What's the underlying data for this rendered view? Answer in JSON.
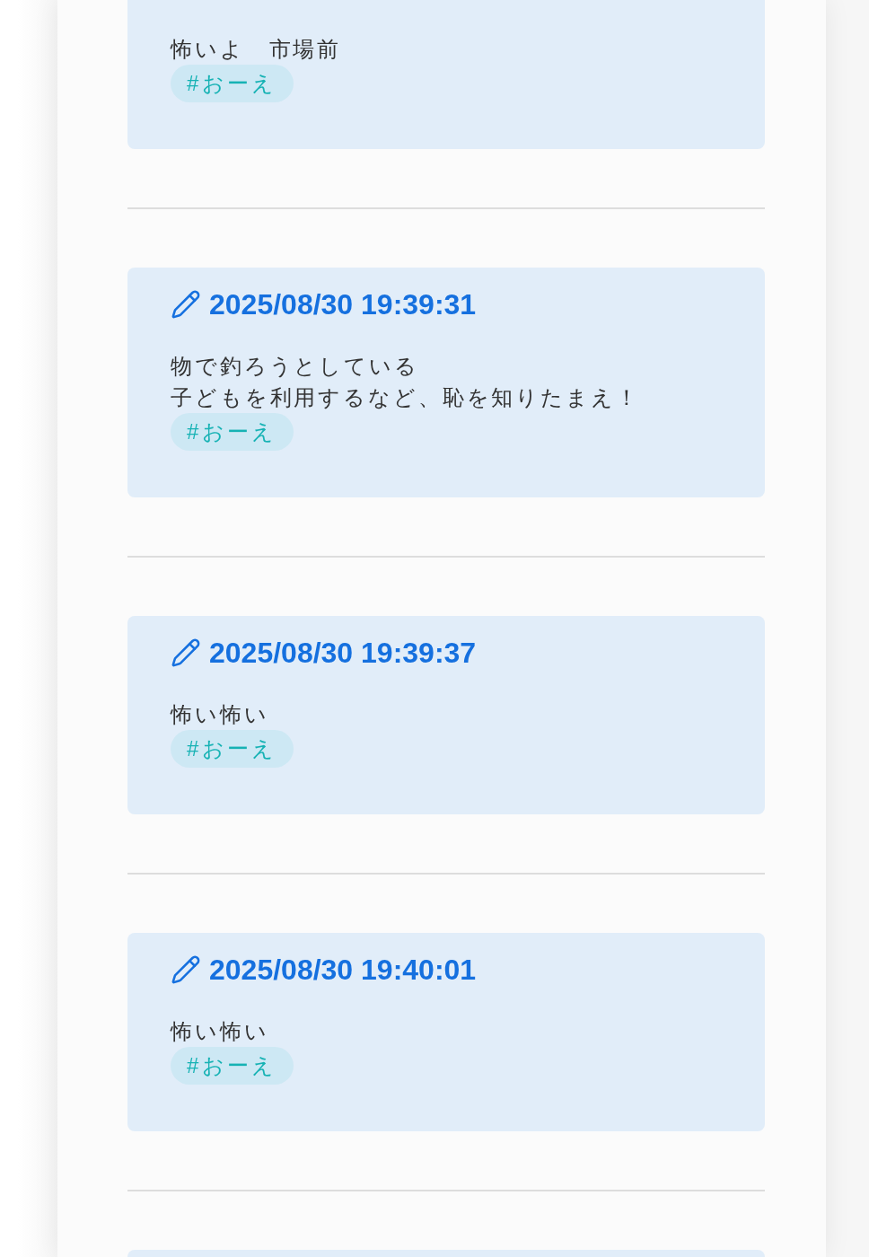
{
  "posts": [
    {
      "lines": [
        "怖いよ　市場前"
      ],
      "tags": [
        "#おーえ"
      ]
    },
    {
      "timestamp": "2025/08/30 19:39:31",
      "lines": [
        "物で釣ろうとしている",
        "子どもを利用するなど、恥を知りたまえ！"
      ],
      "tags": [
        "#おーえ"
      ]
    },
    {
      "timestamp": "2025/08/30 19:39:37",
      "lines": [
        "怖い怖い"
      ],
      "tags": [
        "#おーえ"
      ]
    },
    {
      "timestamp": "2025/08/30 19:40:01",
      "lines": [
        "怖い怖い"
      ],
      "tags": [
        "#おーえ"
      ]
    }
  ],
  "partial_card_below": true
}
